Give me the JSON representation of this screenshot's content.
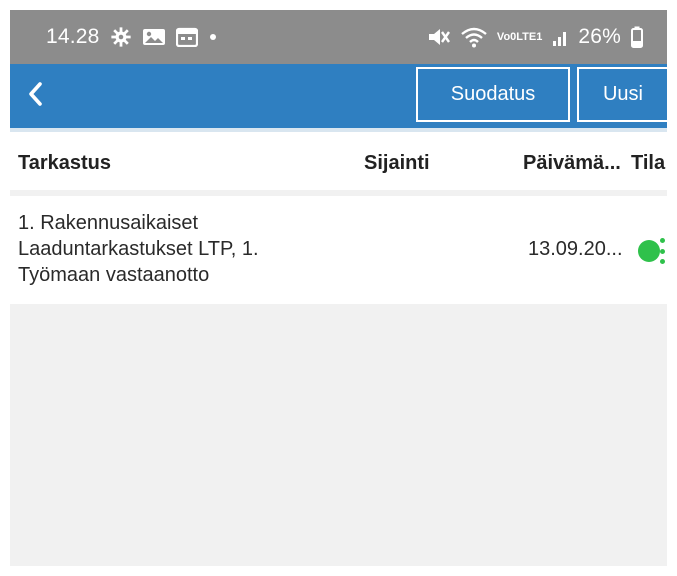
{
  "status_bar": {
    "time": "14.28",
    "battery": "26%",
    "volte_top": "Vo0",
    "volte_bottom": "LTE1",
    "left_icons": [
      "gear-icon",
      "image-icon",
      "calendar-icon",
      "dot-icon"
    ],
    "right_icons": [
      "mute-icon",
      "wifi-icon",
      "signal-icon",
      "battery-icon"
    ]
  },
  "app_bar": {
    "color": "#2f7fc1",
    "back_icon": "chevron-left-icon",
    "filter_label": "Suodatus",
    "new_label": "Uusi"
  },
  "table": {
    "columns": [
      "Tarkastus",
      "Sijainti",
      "Päivämä...",
      "Tila"
    ],
    "rows": [
      {
        "inspection_lines": [
          "1. Rakennusaikaiset",
          "Laaduntarkastukset LTP, 1.",
          "Työmaan vastaanotto"
        ],
        "location": "",
        "date": "13.09.20...",
        "status_color": "#2fc14b"
      }
    ]
  }
}
